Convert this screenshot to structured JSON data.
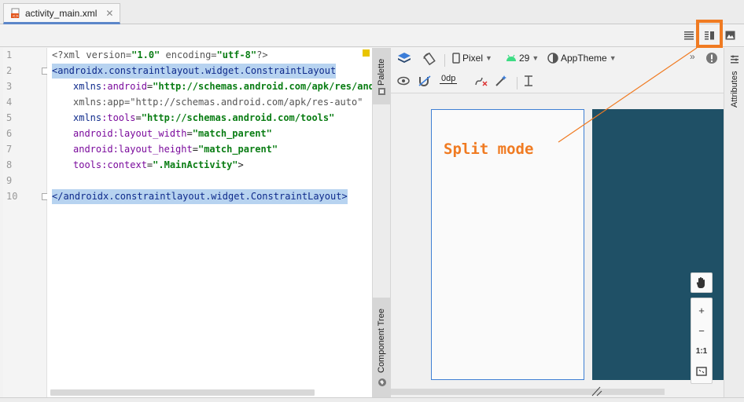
{
  "tab": {
    "label": "activity_main.xml",
    "close": "✕"
  },
  "code": {
    "line_numbers": [
      "1",
      "2",
      "3",
      "4",
      "5",
      "6",
      "7",
      "8",
      "9",
      "10"
    ],
    "l1": {
      "a": "<?xml version=",
      "b": "\"1.0\"",
      "c": " encoding=",
      "d": "\"utf-8\"",
      "e": "?>"
    },
    "l2": "<androidx.constraintlayout.widget.ConstraintLayout",
    "l3": {
      "ns": "xmlns",
      "attr": ":android",
      "eq": "=",
      "val": "\"http://schemas.android.com/apk/res/andr"
    },
    "l4": {
      "text": "xmlns:app=\"http://schemas.android.com/apk/res-auto\""
    },
    "l5": {
      "ns": "xmlns",
      "attr": ":tools",
      "eq": "=",
      "val": "\"http://schemas.android.com/tools\""
    },
    "l6": {
      "ns": "android",
      "attr": ":layout_width",
      "eq": "=",
      "val": "\"match_parent\""
    },
    "l7": {
      "ns": "android",
      "attr": ":layout_height",
      "eq": "=",
      "val": "\"match_parent\""
    },
    "l8": {
      "ns": "tools",
      "attr": ":context",
      "eq": "=",
      "val": "\".MainActivity\"",
      "end": ">"
    },
    "l10": "</androidx.constraintlayout.widget.ConstraintLayout>"
  },
  "side": {
    "palette": "Palette",
    "component_tree": "Component Tree",
    "attributes": "Attributes"
  },
  "toolbar": {
    "device": "Pixel",
    "api": "29",
    "theme": "AppTheme",
    "margin": "0dp",
    "more": "»"
  },
  "zoom": {
    "in": "+",
    "out": "−",
    "actual": "1:1"
  },
  "annotation": {
    "text": "Split mode"
  },
  "colors": {
    "accent": "#f07b22",
    "blueprint": "#1f5066",
    "selection": "#b7d3f0"
  }
}
